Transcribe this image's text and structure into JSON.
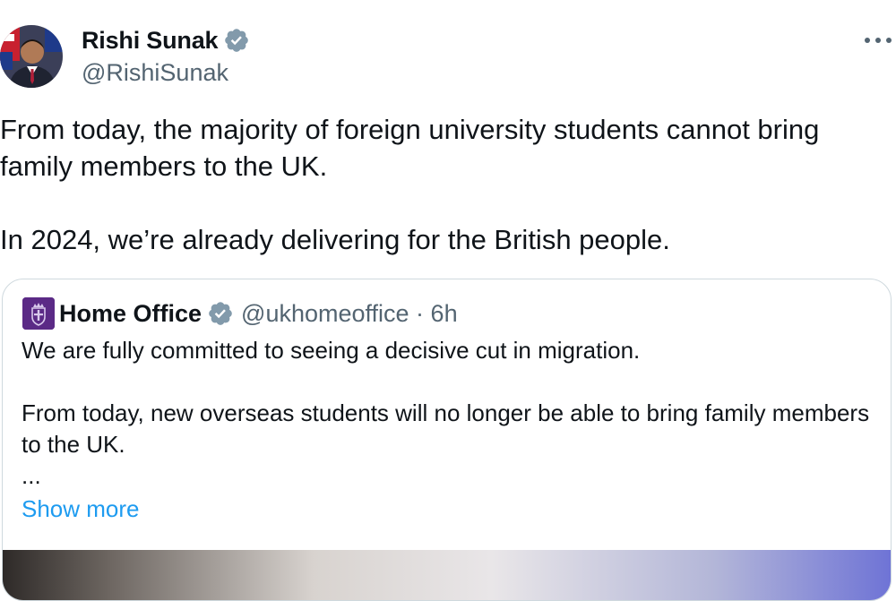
{
  "tweet": {
    "author": {
      "name": "Rishi Sunak",
      "handle": "@RishiSunak",
      "avatar_icon": "profile-photo"
    },
    "more_icon": "more-horizontal-icon",
    "more_label": "···",
    "text_line_1": "From today, the majority of foreign university students cannot bring family members to the UK.",
    "text_line_2": "In 2024, we’re already delivering for the British people."
  },
  "quote": {
    "author": {
      "name": "Home Office",
      "handle": "@ukhomeoffice · 6h",
      "avatar_icon": "royal-crest-icon"
    },
    "text_1": "We are fully committed to seeing a decisive cut in migration.",
    "text_2": "From today, new overseas students will no longer be able to bring family members to the UK.",
    "ellipsis": "...",
    "show_more": "Show more"
  },
  "colors": {
    "text": "#0f1419",
    "secondary": "#536471",
    "link": "#1d9bf0",
    "verified_badge": "#829aab",
    "border": "#cfd9de",
    "home_office_purple": "#5b2a86"
  }
}
